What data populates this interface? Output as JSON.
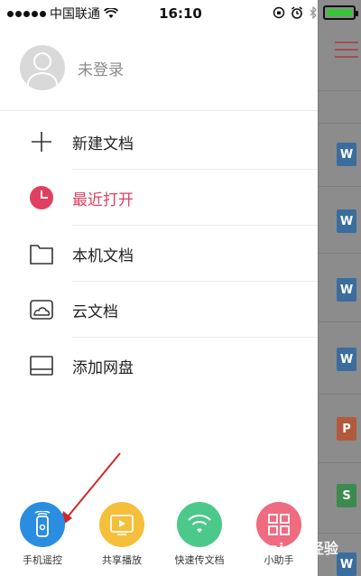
{
  "status_bar": {
    "carrier": "中国联通",
    "time": "16:10"
  },
  "profile": {
    "label": "未登录"
  },
  "menu": {
    "items": [
      {
        "label": "新建文档",
        "icon": "plus-icon",
        "active": false
      },
      {
        "label": "最近打开",
        "icon": "clock-icon",
        "active": true
      },
      {
        "label": "本机文档",
        "icon": "folder-icon",
        "active": false
      },
      {
        "label": "云文档",
        "icon": "cloud-icon",
        "active": false
      },
      {
        "label": "添加网盘",
        "icon": "drive-icon",
        "active": false
      }
    ]
  },
  "dock": {
    "items": [
      {
        "label": "手机遥控",
        "icon": "remote-icon",
        "color": "#2a8de0"
      },
      {
        "label": "共享播放",
        "icon": "play-icon",
        "color": "#f5bf3a"
      },
      {
        "label": "快速传文档",
        "icon": "wifi-icon",
        "color": "#4cc98a"
      },
      {
        "label": "小助手",
        "icon": "grid-icon",
        "color": "#ef6b80"
      }
    ]
  },
  "doc_panel": {
    "files": [
      {
        "letter": "W",
        "type": "word"
      },
      {
        "letter": "W",
        "type": "word"
      },
      {
        "letter": "W",
        "type": "word"
      },
      {
        "letter": "W",
        "type": "word"
      },
      {
        "letter": "P",
        "type": "ppt"
      },
      {
        "letter": "S",
        "type": "sheet"
      },
      {
        "letter": "W",
        "type": "word"
      }
    ]
  },
  "colors": {
    "accent": "#e0405f",
    "battery": "#39c53a",
    "annotation": "#cc2a2a"
  },
  "watermark": {
    "text": "Bai du经验"
  }
}
